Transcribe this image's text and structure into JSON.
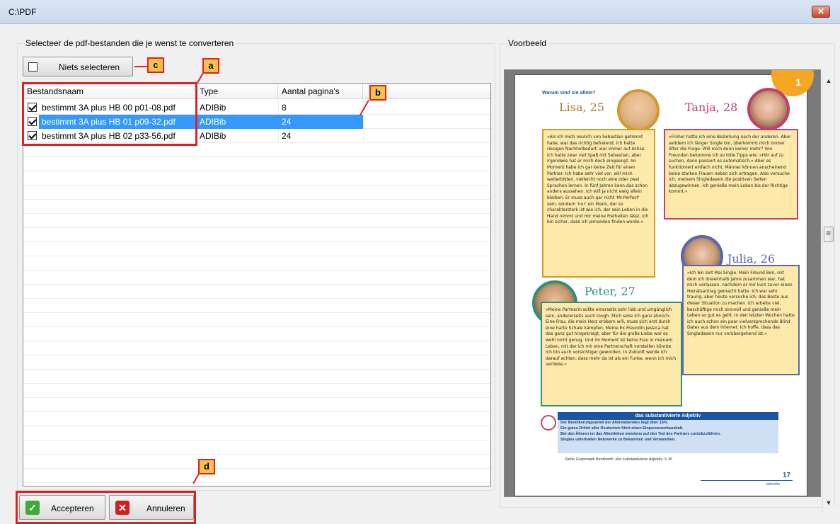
{
  "window": {
    "title": "C:\\PDF",
    "close_symbol": "✕"
  },
  "files_group": {
    "legend": "Selecteer de pdf-bestanden die je wenst te converteren"
  },
  "select_none_button": {
    "label": "Niets selecteren"
  },
  "table": {
    "columns": [
      "Bestandsnaam",
      "Type",
      "Aantal pagina's"
    ],
    "rows": [
      {
        "name": "bestimmt 3A plus HB 00 p01-08.pdf",
        "type": "ADIBib",
        "pages": "8",
        "checked": true
      },
      {
        "name": "bestimmt 3A plus HB 01 p09-32.pdf",
        "type": "ADIBib",
        "pages": "24",
        "checked": true
      },
      {
        "name": "bestimmt 3A plus HB 02 p33-56.pdf",
        "type": "ADIBib",
        "pages": "24",
        "checked": true
      }
    ]
  },
  "callouts": {
    "a": "a",
    "b": "b",
    "c": "c",
    "d": "d"
  },
  "preview_group": {
    "legend": "Voorbeeld"
  },
  "preview_page": {
    "page_number": "1",
    "heading": "Warum sind sie allein?",
    "lisa": {
      "name": "Lisa, 25",
      "text": "»Als ich mich neulich von Sebastian getrennt habe, war das richtig befreiend. Ich hatte riesigen Nachholbedarf, war immer auf Achse. Ich hatte zwar viel Spaß mit Sebastian, aber irgendwie hat er mich doch eingeengt. Im Moment habe ich gar keine Zeit für einen Partner: Ich habe sehr viel vor, will mich weiterbilden, vielleicht noch eine oder zwei Sprachen lernen. In fünf Jahren kann das schon anders aussehen. Ich will ja nicht ewig allein bleiben. Er muss auch gar nicht 'Mr.Perfect' sein, sondern 'nur' ein Mann, der so charakterstark ist wie ich, der sein Leben in die Hand nimmt und mir meine Freiheiten lässt. Ich bin sicher, dass ich jemanden finden werde.«"
    },
    "tanja": {
      "name": "Tanja, 28",
      "text": "»Früher hatte ich eine Beziehung nach der anderen. Aber seitdem ich länger Single bin, überkommt mich immer öfter die Frage: Will mich denn keiner mehr? Von Freunden bekomme ich so tolle Tipps wie: »Hör auf zu suchen, dann passiert es automatisch.« Aber es funktioniert einfach nicht. Männer können anscheinend keine starken Frauen neben sich ertragen. Also versuche ich, meinem Singledasein die positiven Seiten abzugewinnen. Ich genieße mein Leben bis der Richtige kommt.«"
    },
    "julia": {
      "name": "Julia, 26",
      "text": "»Ich bin seit Mai Single. Mein Freund Ben, mit dem ich dreieinhalb Jahre zusammen war, hat mich verlassen, nachdem er mir kurz zuvor einen Heiratsantrag gemacht hatte. Ich war sehr traurig, aber heute versuche ich, das Beste aus dieser Situation zu machen. Ich arbeite viel, beschäftige mich sinnvoll und genieße mein Leben so gut es geht. In den letzten Wochen hatte ich auch schon ein paar vielversprechende Blind Dates aus dem Internet. Ich hoffe, dass das Singledasein nur vorübergehend ist.«"
    },
    "peter": {
      "name": "Peter, 27",
      "text": "»Meine Partnerin sollte einerseits sehr lieb und umgänglich sein, andererseits auch tough. Mich sehe ich ganz ähnlich: Eine Frau, die mein Herz erobern will, muss sich erst durch eine harte Schale kämpfen. Meine Ex-Freundin Jessica hat das ganz gut hingekriegt, aber für die große Liebe war es wohl nicht genug. Und im Moment ist keine Frau in meinem Leben, mit der ich mir eine Partnerschaft vorstellen könnte. Ich bin auch vorsichtiger geworden: In Zukunft werde ich darauf achten, dass mehr da ist als ein Funke, wenn ich mich verliebe.«"
    },
    "grammar_title": "das substantivierte Adjektiv",
    "grammar_lines": [
      "Der Bevölkerungsanteil der Alleinlebenden liegt über 16%.",
      "Ein gutes Drittel aller Deutschen führt einen Einpersonenhaushalt.",
      "Bei den Älteren ist das Alleinleben meistens auf den Tod des Partners zurückzuführen.",
      "Singles unterhalten Netzwerke zu Bekannten und Verwandten."
    ],
    "grammar_ref": "Siehe Grammatik Bestimmt!: das substantivierte Adjektiv, S.36",
    "footer_number": "17",
    "footer_word": "siebzehn"
  },
  "accept_button": {
    "label": "Accepteren"
  },
  "cancel_button": {
    "label": "Annuleren"
  },
  "colors": {
    "selection": "#3399ff",
    "callout_fill": "#f9c34a",
    "callout_border": "#e02020"
  }
}
